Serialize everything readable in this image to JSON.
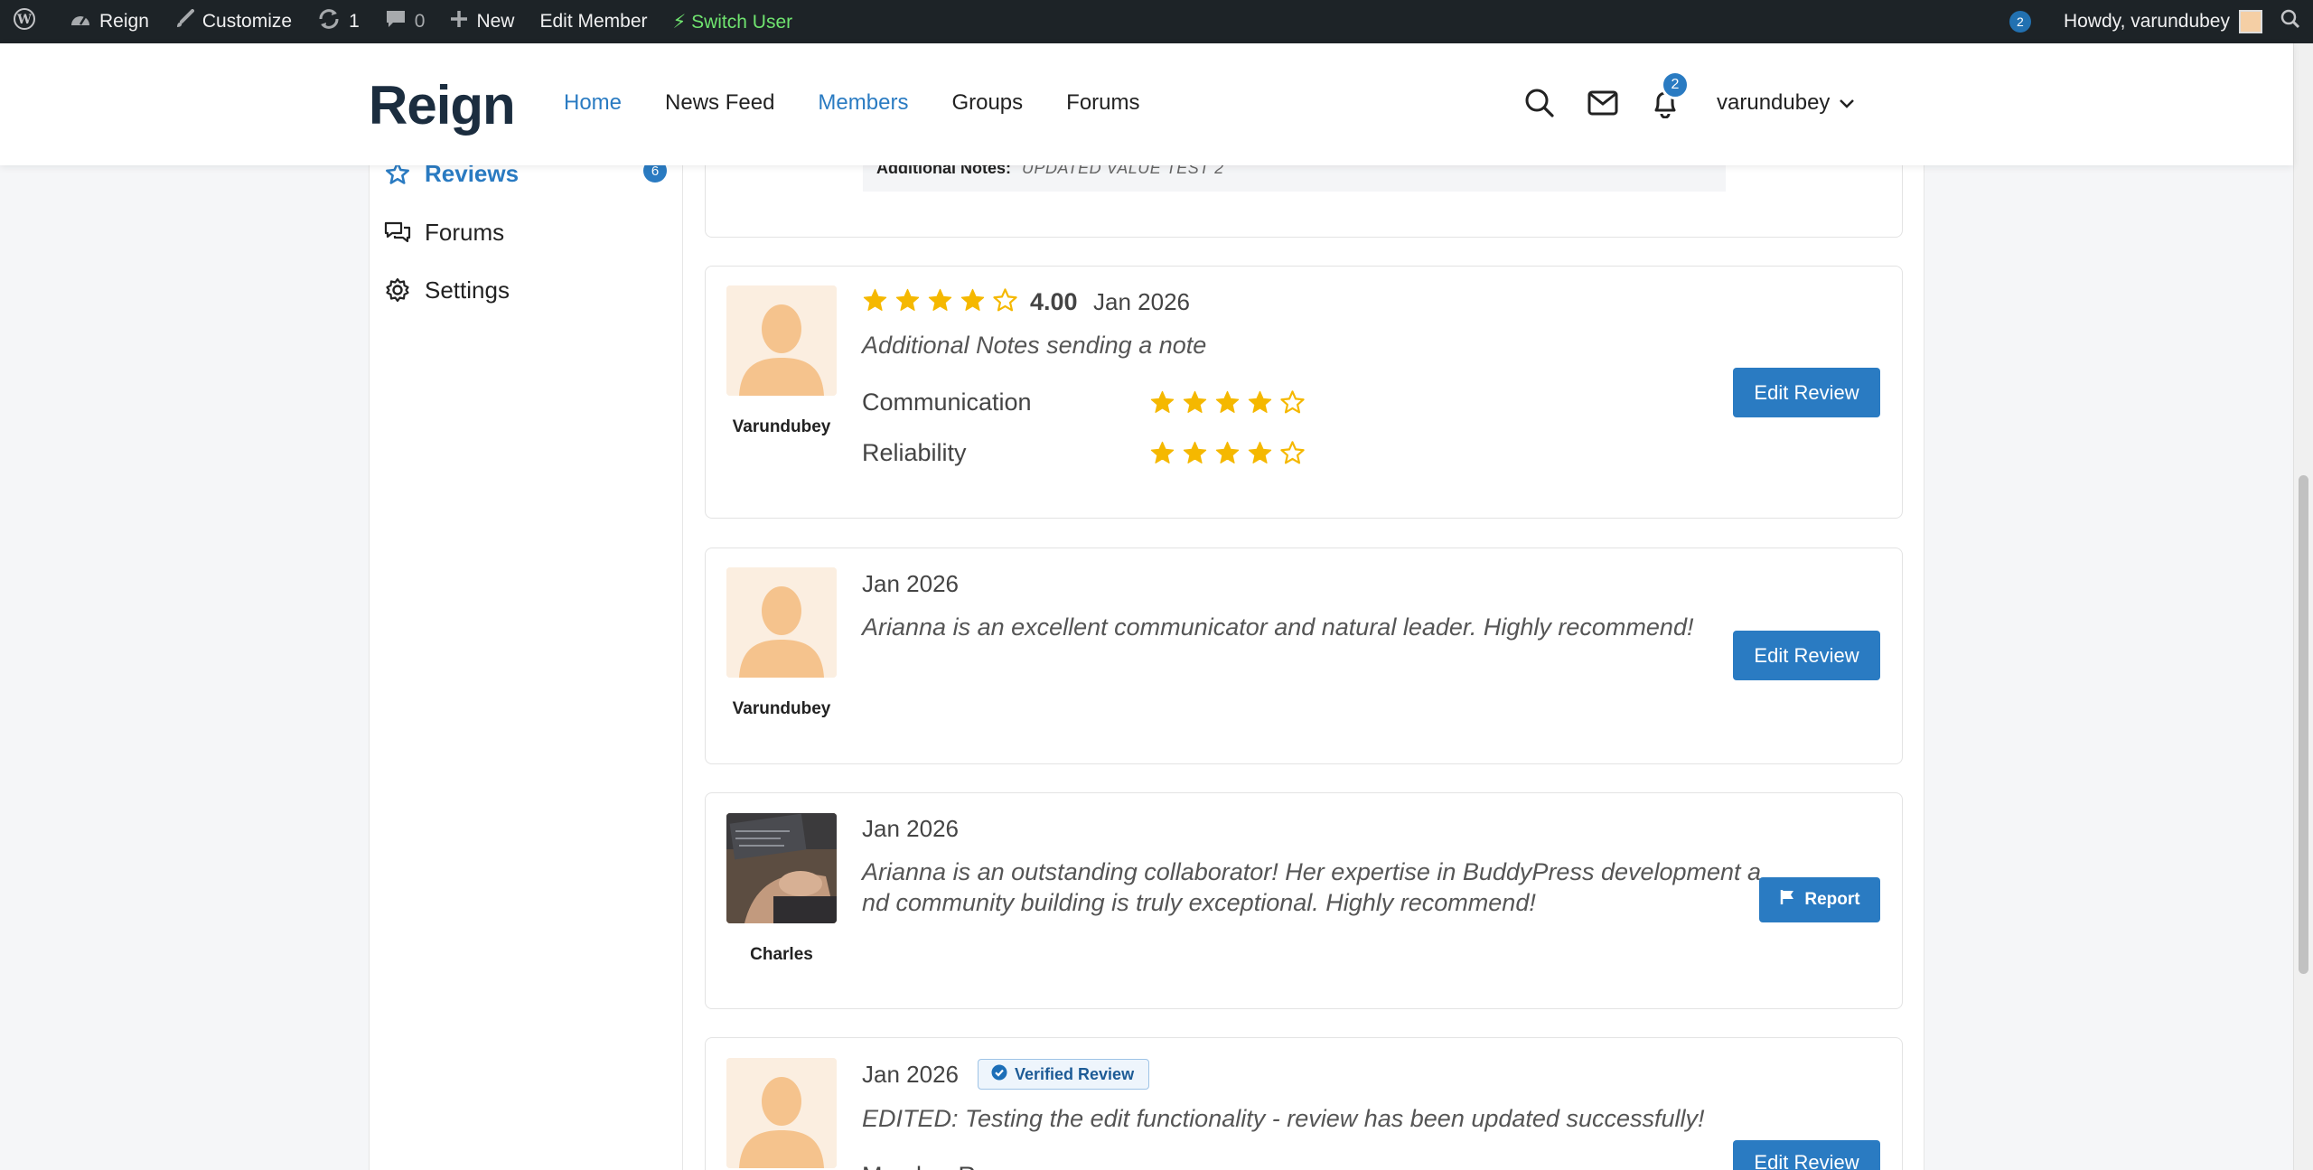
{
  "adminbar": {
    "site": "Reign",
    "customize": "Customize",
    "updates": "1",
    "comments": "0",
    "new": "New",
    "edit_member": "Edit Member",
    "switch_user": "⚡ Switch User",
    "notif_count": "2",
    "howdy": "Howdy, varundubey"
  },
  "header": {
    "logo": "Reign",
    "nav": [
      "Home",
      "News Feed",
      "Members",
      "Groups",
      "Forums"
    ],
    "notif_count": "2",
    "username": "varundubey"
  },
  "sidebar": {
    "items": [
      {
        "label": "Reviews",
        "count": "6",
        "icon": "star-icon"
      },
      {
        "label": "Forums",
        "icon": "chat-icon"
      },
      {
        "label": "Settings",
        "icon": "gear-icon"
      }
    ]
  },
  "reviews": {
    "top_notes": {
      "label": "Additional Notes:",
      "value": "UPDATED VALUE TEST 2"
    },
    "items": [
      {
        "reviewer": "Varundubey",
        "rating": "4.00",
        "rating_value": 4,
        "date": "Jan 2026",
        "text": "Additional Notes sending a note",
        "criteria": [
          {
            "label": "Communication",
            "stars": 4
          },
          {
            "label": "Reliability",
            "stars": 4
          }
        ],
        "button": "Edit Review"
      },
      {
        "reviewer": "Varundubey",
        "date": "Jan 2026",
        "text": "Arianna is an excellent communicator and natural leader. Highly recommend!",
        "button": "Edit Review"
      },
      {
        "reviewer": "Charles",
        "date": "Jan 2026",
        "text_line1": "Arianna is an outstanding collaborator! Her expertise in BuddyPress development a",
        "text_line2": "nd community building is truly exceptional. Highly recommend!",
        "button": "Report"
      },
      {
        "date": "Jan 2026",
        "badge": "Verified Review",
        "text": "EDITED: Testing the edit functionality - review has been updated successfully!",
        "criteria_partial": "Member R",
        "button": "Edit Review"
      }
    ]
  },
  "colors": {
    "accent": "#2a7bc2",
    "star": "#f5b800",
    "adminbar": "#1d2327"
  }
}
